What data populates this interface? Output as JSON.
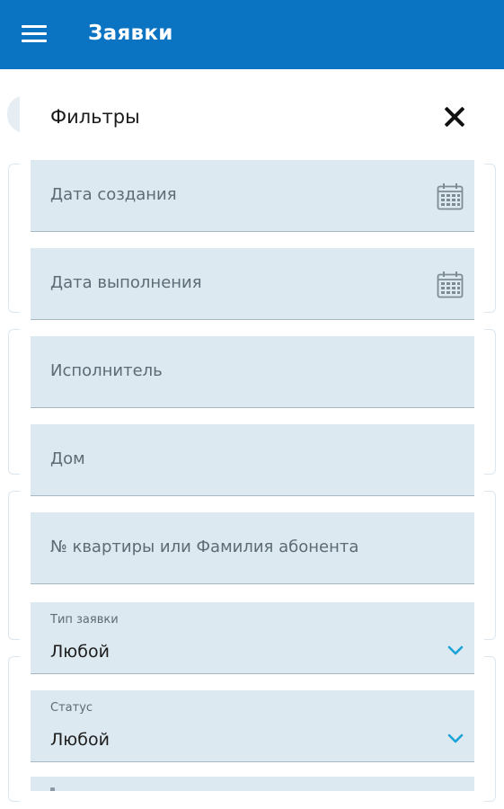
{
  "app_bar": {
    "title": "Заявки",
    "menu_icon": "hamburger-menu-icon",
    "color": "#0a73c2"
  },
  "filters": {
    "title": "Фильтры",
    "close_icon": "close-icon",
    "fields": {
      "created_date": {
        "placeholder": "Дата создания",
        "icon": "calendar-icon"
      },
      "completed_date": {
        "placeholder": "Дата выполнения",
        "icon": "calendar-icon"
      },
      "executor": {
        "placeholder": "Исполнитель"
      },
      "house": {
        "placeholder": "Дом"
      },
      "apartment": {
        "placeholder": "№ квартиры или Фамилия абонента"
      },
      "request_type": {
        "label": "Тип заявки",
        "value": "Любой",
        "icon": "chevron-down-icon"
      },
      "status": {
        "label": "Статус",
        "value": "Любой",
        "icon": "chevron-down-icon"
      }
    }
  },
  "colors": {
    "accent": "#0a73c2",
    "field_background": "#dde9f0",
    "chevron": "#1aa3d6"
  }
}
